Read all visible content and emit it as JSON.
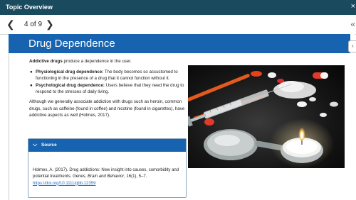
{
  "topbar": {
    "title": "Topic Overview",
    "close": "×"
  },
  "nav": {
    "prev": "❮",
    "counter": "4 of 9",
    "next": "❯",
    "right_glyph": "«"
  },
  "banner": {
    "title": "Drug Dependence"
  },
  "side_tab": {
    "glyph": "‹"
  },
  "content": {
    "intro_bold": "Addictive drugs",
    "intro_rest": " produce a dependence in the user.",
    "bullets": [
      {
        "term": "Physiological drug dependence:",
        "text": " The body becomes so accustomed to functioning in the presence of a drug that it cannot function without it."
      },
      {
        "term": "Psychological drug dependence:",
        "text": " Users believe that they need the drug to respond to the stresses of daily living."
      }
    ],
    "paragraph": "Although we generally associate addiction with drugs such as heroin, common drugs, such as caffeine (found in coffee) and nicotine (found in cigarettes), have addictive aspects as well (Holmes, 2017)."
  },
  "source": {
    "chevron": "⌵",
    "label": "Source",
    "citation_a": "Holmes, A. (2017). Drug addictions: New insight into causes, comorbidity and potential treatments. ",
    "journal": "Genes, Brain and Behavior",
    "citation_b": ", 16",
    "citation_c": "(1), 5–7. ",
    "link": "https://doi.org/10.1111/gbb.12359"
  }
}
